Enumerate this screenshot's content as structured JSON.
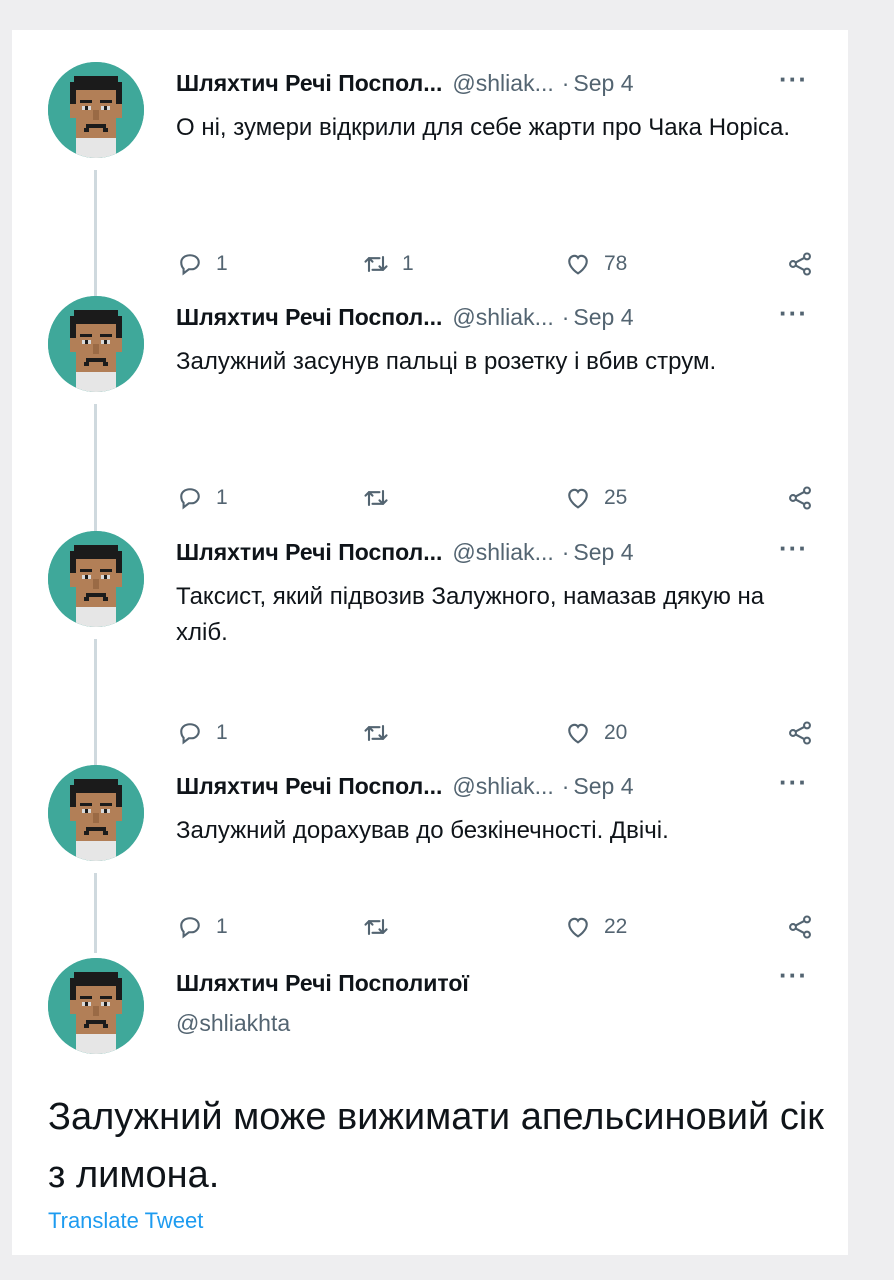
{
  "colors": {
    "accent": "#1d9bf0",
    "avatar_bg": "#3fa89a",
    "muted": "#536471"
  },
  "tweets": [
    {
      "name": "Шляхтич Речі Поспол...",
      "handle": "@shliak...",
      "sep": "·",
      "date": "Sep 4",
      "more": "···",
      "text": "О ні, зумери відкрили для себе жарти про Чака Норіса.",
      "replies": "1",
      "retweets": "1",
      "likes": "78"
    },
    {
      "name": "Шляхтич Речі Поспол...",
      "handle": "@shliak...",
      "sep": "·",
      "date": "Sep 4",
      "more": "···",
      "text": "Залужний засунув пальці в розетку і вбив струм.",
      "replies": "1",
      "retweets": "",
      "likes": "25"
    },
    {
      "name": "Шляхтич Речі Поспол...",
      "handle": "@shliak...",
      "sep": "·",
      "date": "Sep 4",
      "more": "···",
      "text": "Таксист, який підвозив Залужного, намазав дякую на хліб.",
      "replies": "1",
      "retweets": "",
      "likes": "20"
    },
    {
      "name": "Шляхтич Речі Поспол...",
      "handle": "@shliak...",
      "sep": "·",
      "date": "Sep 4",
      "more": "···",
      "text": "Залужний дорахував до безкінечності. Двічі.",
      "replies": "1",
      "retweets": "",
      "likes": "22"
    }
  ],
  "main": {
    "name": "Шляхтич Речі Посполитої",
    "handle": "@shliakhta",
    "more": "···",
    "text": "Залужний може вижимати апельсиновий сік з лимона.",
    "translate": "Translate Tweet"
  },
  "icons": [
    "reply-icon",
    "retweet-icon",
    "like-icon",
    "share-icon",
    "more-icon",
    "avatar-pixel-face"
  ]
}
